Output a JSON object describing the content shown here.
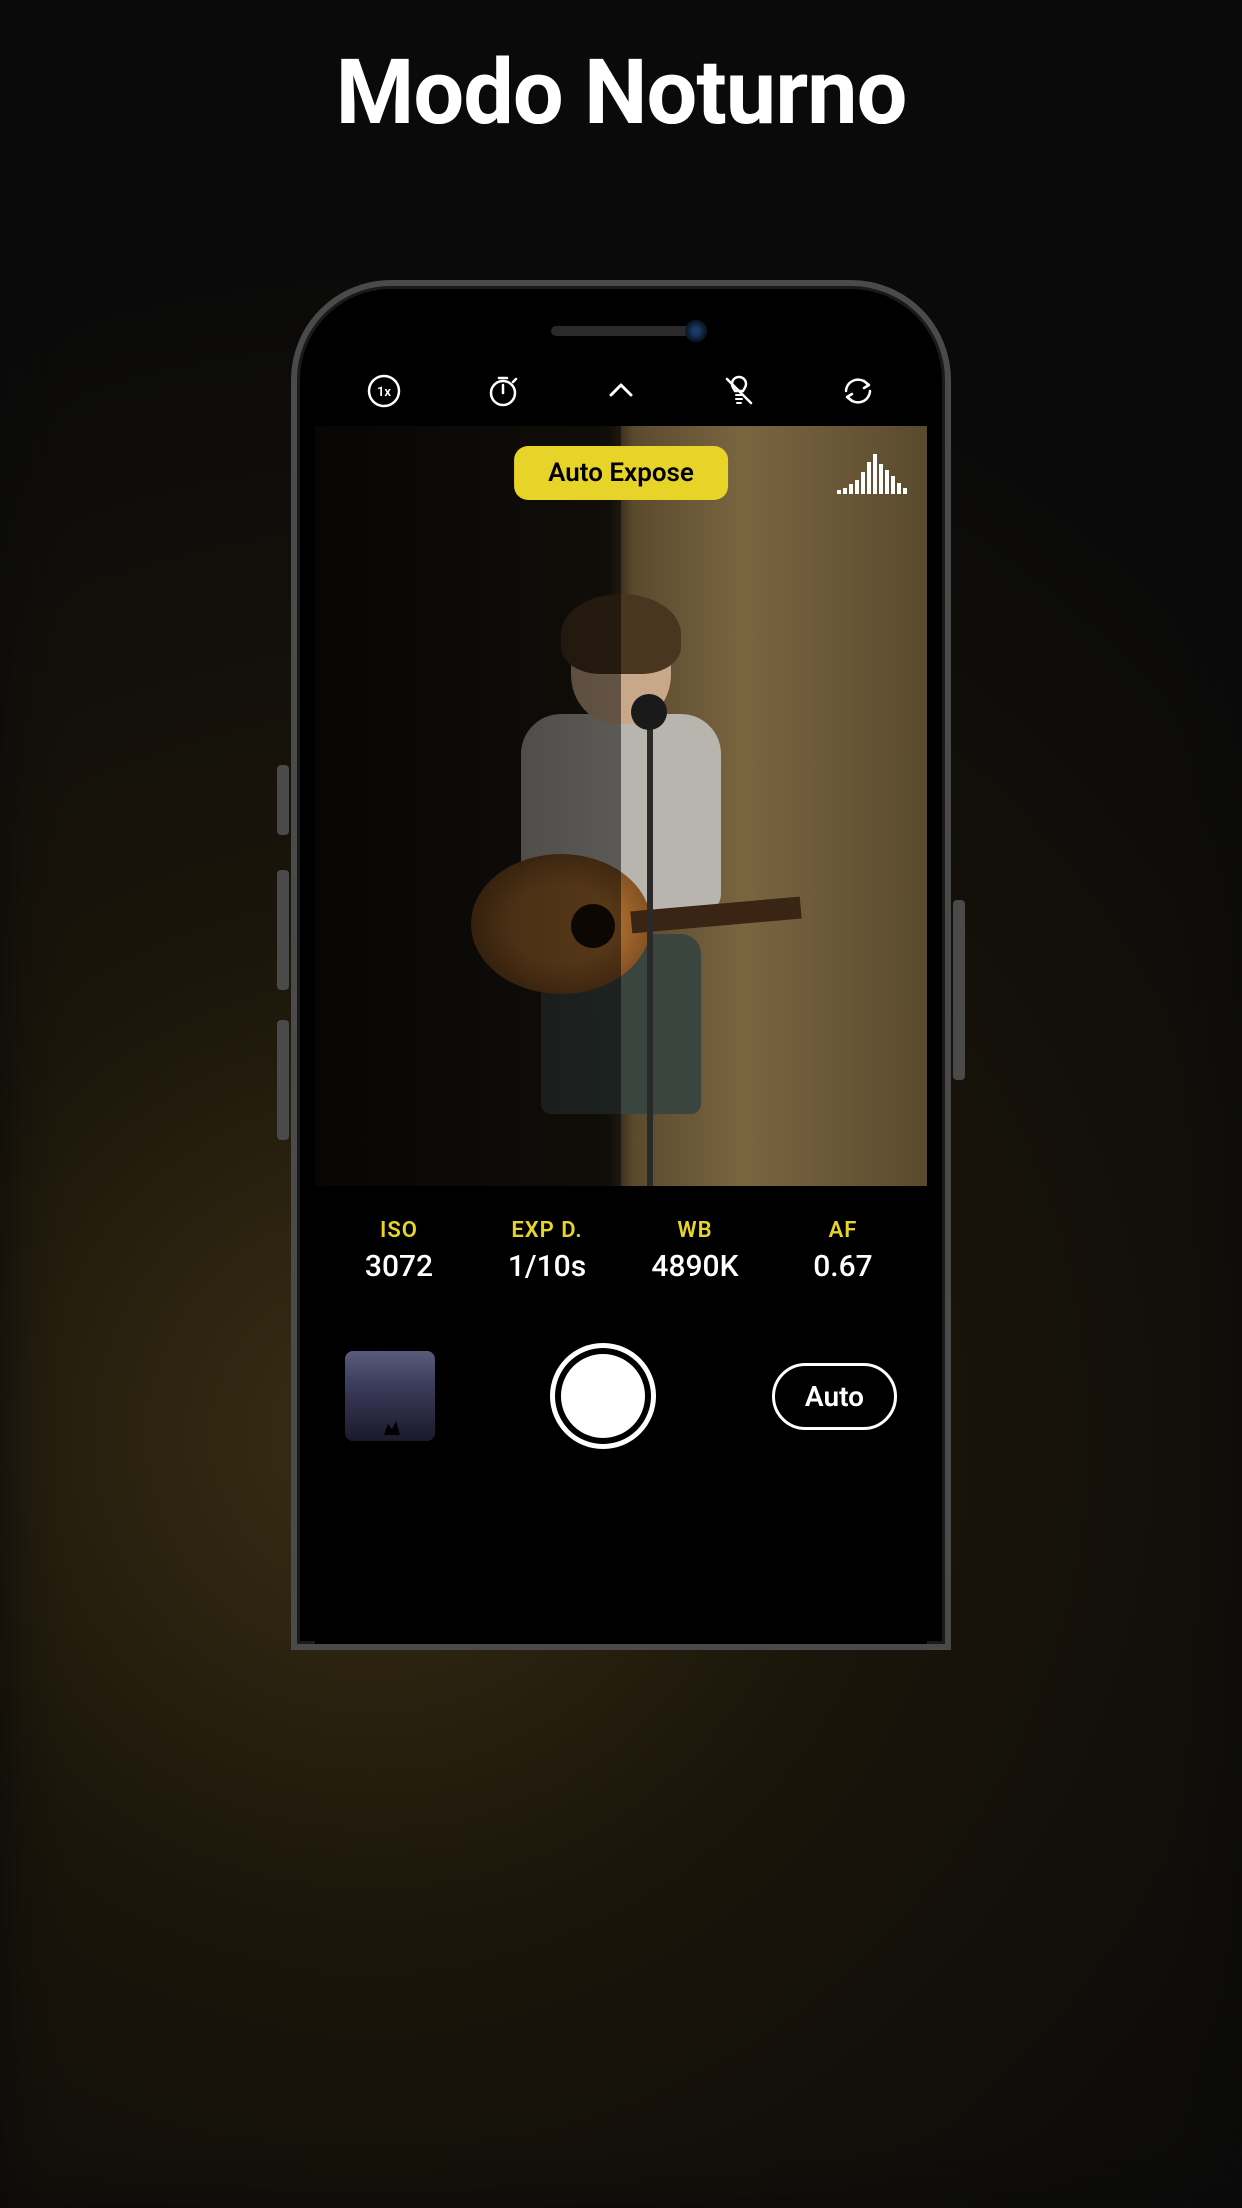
{
  "headline": "Modo Noturno",
  "topbar": {
    "zoom_label": "1x",
    "icons": {
      "zoom": "zoom-1x-icon",
      "timer": "timer-icon",
      "expand": "chevron-up-icon",
      "flash": "flash-off-icon",
      "switch": "camera-switch-icon"
    }
  },
  "viewfinder": {
    "auto_expose_label": "Auto Expose",
    "histogram_bars": [
      5,
      8,
      12,
      18,
      28,
      40,
      50,
      38,
      30,
      22,
      14,
      8
    ]
  },
  "params": [
    {
      "label": "ISO",
      "value": "3072"
    },
    {
      "label": "EXP D.",
      "value": "1/10s"
    },
    {
      "label": "WB",
      "value": "4890K"
    },
    {
      "label": "AF",
      "value": "0.67"
    }
  ],
  "bottombar": {
    "mode_label": "Auto"
  },
  "colors": {
    "accent": "#e8d428"
  }
}
